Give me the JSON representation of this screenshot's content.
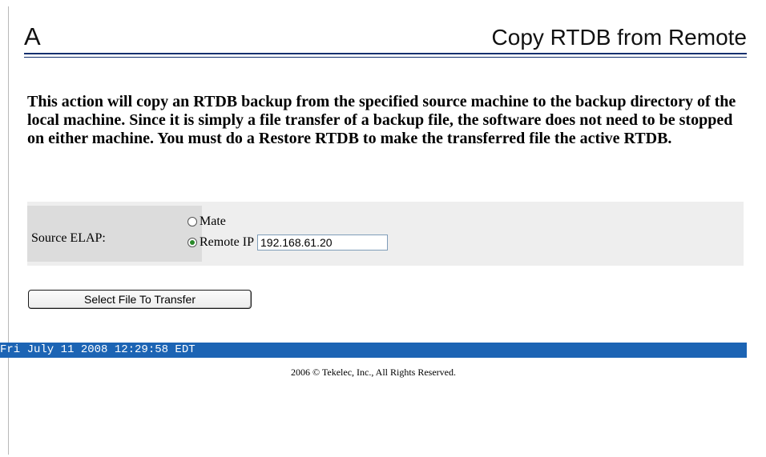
{
  "header": {
    "letter": "A",
    "title": "Copy RTDB from Remote"
  },
  "description": "This action will copy an RTDB backup from the specified source machine to the backup directory of the local machine. Since it is simply a file transfer of a backup file, the software does not need to be stopped on either machine. You must do a Restore RTDB to make the transferred file the active RTDB.",
  "form": {
    "source_label": "Source ELAP:",
    "options": [
      {
        "label": "Mate",
        "selected": false
      },
      {
        "label": "Remote IP",
        "selected": true
      }
    ],
    "remote_ip_value": "192.168.61.20"
  },
  "actions": {
    "select_file_label": "Select File To Transfer"
  },
  "status": {
    "datetime": "Fri July 11 2008 12:29:58 EDT"
  },
  "footer": {
    "copyright": "2006 © Tekelec, Inc., All Rights Reserved."
  },
  "colors": {
    "status_bar": "#1c64b4",
    "header_rule": "#14306e",
    "form_panel": "#eeeeee",
    "form_label_cell": "#dcdcdc"
  }
}
